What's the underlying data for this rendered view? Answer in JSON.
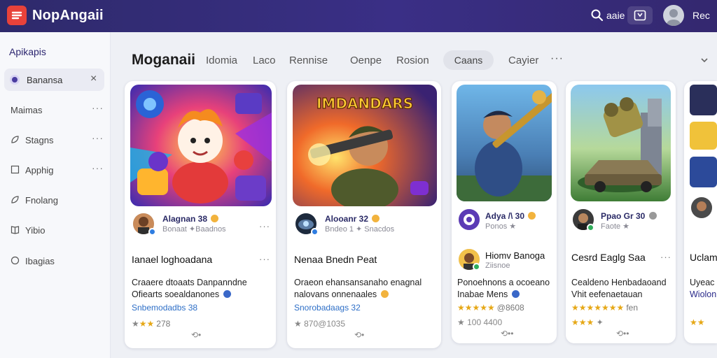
{
  "header": {
    "app_title": "NopAngaii",
    "search_label": "aaie",
    "user_label": "Rec"
  },
  "sidebar": {
    "heading": "Apikapis",
    "active_item": "Banansa",
    "items": [
      {
        "label": "Maimas",
        "icon": "none"
      },
      {
        "label": "Stagns",
        "icon": "leaf-icon"
      },
      {
        "label": "Apphig",
        "icon": "square-icon"
      },
      {
        "label": "Fnolang",
        "icon": "leaf-icon"
      },
      {
        "label": "Yibio",
        "icon": "book-icon"
      },
      {
        "label": "Ibagias",
        "icon": "circle-icon"
      }
    ]
  },
  "main": {
    "page_title": "Moganaii",
    "tabs": [
      "Idomia",
      "Laco",
      "Rennise",
      "Oenpe",
      "Rosion",
      "Caans",
      "Cayier"
    ],
    "active_tab": "Caans"
  },
  "cards": [
    {
      "author": "Alagnan 38",
      "sub": "Bonaat  ✦Baadnos",
      "title": "Ianael loghoadana",
      "desc1": "Craaere dtoaats Danpanndne",
      "desc2": "Ofiearts soealdanones",
      "link": "Snbemodadbs 38",
      "stars": "★★",
      "rating": "278",
      "footer": "⟲•"
    },
    {
      "author": "Alooanr 32",
      "sub": "Bndeo 1  ✦ Snacdos",
      "title": "Nenaa Bnedn Peat",
      "desc1": "Oraeon ehansansanaho enagnal",
      "desc2": "nalovans onnenaales",
      "link": "Snorobadaags 32",
      "stars": "★",
      "rating": "870@1035",
      "footer": "⟲•"
    },
    {
      "author": "Adya /\\ 30",
      "sub": "Ponos ★",
      "title": "",
      "desc1": "",
      "desc2": "",
      "author2": "Hiomv Banoga",
      "sub2": "Ziisnoe",
      "desc3": "Ponoehnons a ocoeano",
      "desc4": "Inabae Mens",
      "stars": "★★★★★",
      "rating": "@8608",
      "footer_rating": "100 4400",
      "footer": "⟲••"
    },
    {
      "author": "Ppao Gr 30",
      "sub": "Faote ★",
      "title": "Cesrd Eaglg Saa",
      "desc1": "Cealdeno Henbadaoand",
      "desc2": "Vhit eefenaetauan",
      "link": "",
      "stars": "★★★★★★★",
      "rating": "fen",
      "footer": "⟲••"
    },
    {
      "title": "Uclam",
      "desc1": "Uyeac",
      "desc2": "Wiolon"
    }
  ]
}
